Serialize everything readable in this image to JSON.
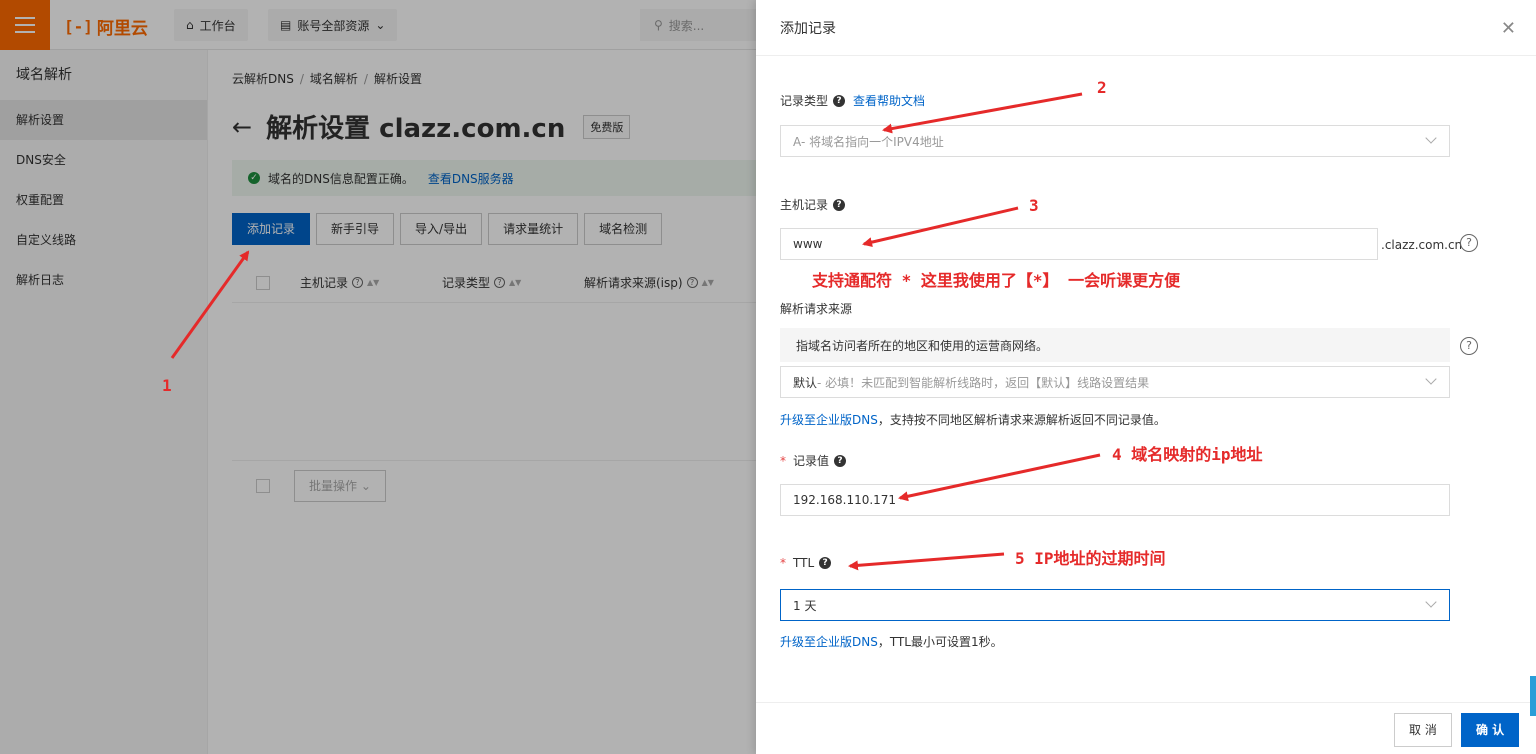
{
  "topbar": {
    "logo": "阿里云",
    "workbench": "工作台",
    "resources": "账号全部资源",
    "search_placeholder": "搜索..."
  },
  "sidebar": {
    "title": "域名解析",
    "items": [
      {
        "label": "解析设置",
        "active": true
      },
      {
        "label": "DNS安全"
      },
      {
        "label": "权重配置"
      },
      {
        "label": "自定义线路"
      },
      {
        "label": "解析日志"
      }
    ]
  },
  "breadcrumb": [
    "云解析DNS",
    "域名解析",
    "解析设置"
  ],
  "page": {
    "title": "解析设置 clazz.com.cn",
    "badge": "免费版",
    "notice": "域名的DNS信息配置正确。",
    "notice_link": "查看DNS服务器"
  },
  "toolbar": [
    "添加记录",
    "新手引导",
    "导入/导出",
    "请求量统计",
    "域名检测"
  ],
  "table": {
    "headers": [
      "主机记录",
      "记录类型",
      "解析请求来源(isp)"
    ],
    "batch": "批量操作"
  },
  "drawer": {
    "title": "添加记录",
    "record_type": {
      "label": "记录类型",
      "help_link": "查看帮助文档",
      "value": "A- 将域名指向一个IPV4地址"
    },
    "host": {
      "label": "主机记录",
      "value": "www",
      "suffix": ".clazz.com.cn"
    },
    "source": {
      "label": "解析请求来源",
      "info": "指域名访问者所在的地区和使用的运营商网络。",
      "value_strong": "默认",
      "value_rest": " - 必填！未匹配到智能解析线路时，返回【默认】线路设置结果",
      "hint_link": "升级至企业版DNS",
      "hint_text": "，支持按不同地区解析请求来源解析返回不同记录值。"
    },
    "record_value": {
      "label": "记录值",
      "value": "192.168.110.171"
    },
    "ttl": {
      "label": "TTL",
      "value": "1 天",
      "hint_link": "升级至企业版DNS",
      "hint_text": "，TTL最小可设置1秒。"
    },
    "cancel": "取 消",
    "confirm": "确 认"
  },
  "annotations": {
    "n1": "1",
    "n2": "2",
    "n3": "3",
    "wildcard": "支持通配符 *   这里我使用了【*】 一会听课更方便",
    "n4": "4 域名映射的ip地址",
    "n5": "5 IP地址的过期时间"
  },
  "colors": {
    "brand": "#ff6a00",
    "primary": "#0064c8",
    "annotation": "#e52a2a"
  }
}
